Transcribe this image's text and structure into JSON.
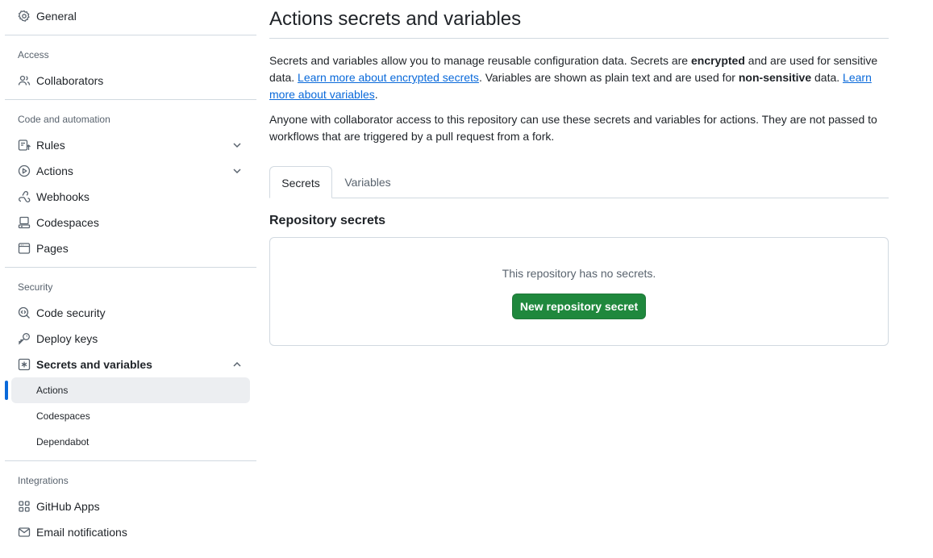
{
  "sidebar": {
    "general": "General",
    "sections": {
      "access": "Access",
      "code_automation": "Code and automation",
      "security": "Security",
      "integrations": "Integrations"
    },
    "items": {
      "collaborators": "Collaborators",
      "rules": "Rules",
      "actions": "Actions",
      "webhooks": "Webhooks",
      "codespaces": "Codespaces",
      "pages": "Pages",
      "code_security": "Code security",
      "deploy_keys": "Deploy keys",
      "secrets_and_variables": "Secrets and variables",
      "github_apps": "GitHub Apps",
      "email_notifications": "Email notifications"
    },
    "sub_items": {
      "actions": "Actions",
      "codespaces": "Codespaces",
      "dependabot": "Dependabot"
    },
    "active_color": "#0969da"
  },
  "main": {
    "title": "Actions secrets and variables",
    "intro": {
      "t1": "Secrets and variables allow you to manage reusable configuration data. Secrets are ",
      "b1": "encrypted",
      "t2": " and are used for sensitive data. ",
      "link1": "Learn more about encrypted secrets",
      "t3": ". Variables are shown as plain text and are used for ",
      "b2": "non-sensitive",
      "t4": " data. ",
      "link2": "Learn more about variables",
      "t5": "."
    },
    "notice": "Anyone with collaborator access to this repository can use these secrets and variables for actions. They are not passed to workflows that are triggered by a pull request from a fork.",
    "tabs": [
      "Secrets",
      "Variables"
    ],
    "section_title": "Repository secrets",
    "empty_message": "This repository has no secrets.",
    "new_button": "New repository secret",
    "button_color": "#1f883d",
    "link_color": "#0969da"
  },
  "icons": [
    "gear-icon",
    "people-icon",
    "rules-icon",
    "play-icon",
    "webhook-icon",
    "codespaces-icon",
    "browser-icon",
    "codescan-icon",
    "key-icon",
    "asterisk-icon",
    "apps-icon",
    "mail-icon",
    "chevron-down-icon",
    "chevron-up-icon"
  ]
}
